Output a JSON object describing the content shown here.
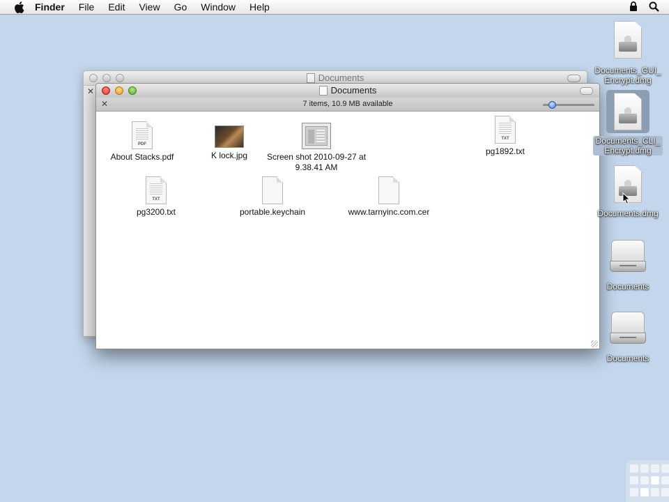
{
  "menubar": {
    "app_name": "Finder",
    "items": [
      "File",
      "Edit",
      "View",
      "Go",
      "Window",
      "Help"
    ]
  },
  "back_window": {
    "title": "Documents"
  },
  "front_window": {
    "title": "Documents",
    "status": "7 items, 10.9 MB available",
    "files": [
      {
        "name": "About Stacks.pdf",
        "kind": "pdf",
        "tag": "PDF"
      },
      {
        "name": "K lock.jpg",
        "kind": "image"
      },
      {
        "name": "Screen shot 2010-09-27 at 9.38.41 AM",
        "kind": "screenshot"
      },
      {
        "name": "pg1892.txt",
        "kind": "txt",
        "tag": "TXT"
      },
      {
        "name": "pg3200.txt",
        "kind": "txt",
        "tag": "TXT"
      },
      {
        "name": "portable.keychain",
        "kind": "generic"
      },
      {
        "name": "www.tarnyinc.com.cer",
        "kind": "generic"
      }
    ]
  },
  "desktop": {
    "items": [
      {
        "name": "Documents_GUI_Encrypt.dmg",
        "kind": "dmg"
      },
      {
        "name": "Documents_CLI_Encrypt.dmg",
        "kind": "dmg",
        "selected": true
      },
      {
        "name": "Documents.dmg",
        "kind": "dmg"
      },
      {
        "name": "Documents",
        "kind": "volume"
      },
      {
        "name": "Documents",
        "kind": "volume"
      }
    ]
  },
  "icons": {
    "apple": "apple-icon",
    "lock": "lock-icon",
    "spotlight": "spotlight-search-icon"
  },
  "colors": {
    "desktop_bg": "#c3d6ec",
    "close": "#d8281e",
    "minimize": "#e79a1d",
    "zoom": "#4fa42a"
  }
}
